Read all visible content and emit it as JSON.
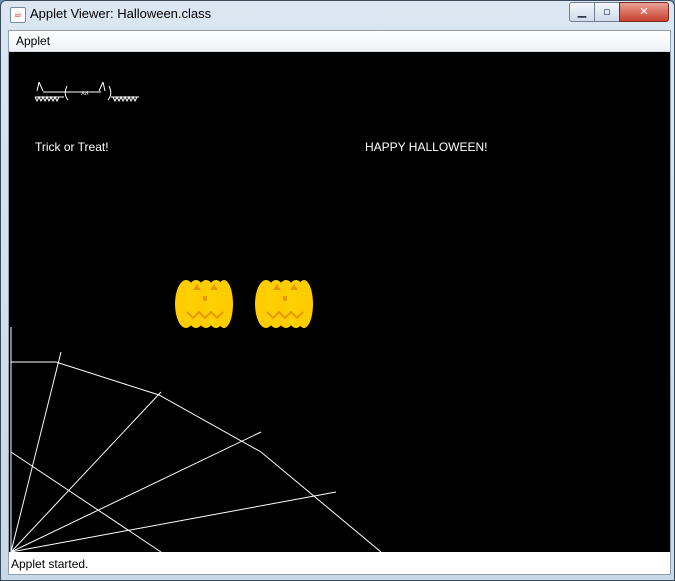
{
  "window": {
    "title": "Applet Viewer: Halloween.class",
    "icon": "java-cup-icon"
  },
  "controls": {
    "minimize": "minimize-icon",
    "maximize": "maximize-icon",
    "close": "close-icon"
  },
  "menu": {
    "items": [
      "Applet"
    ]
  },
  "applet": {
    "text_left": "Trick or Treat!",
    "text_right": "HAPPY HALLOWEEN!",
    "background": "#000000",
    "pumpkin_color": "#ffcc00",
    "line_color": "#ffffff"
  },
  "status": {
    "text": "Applet started."
  }
}
